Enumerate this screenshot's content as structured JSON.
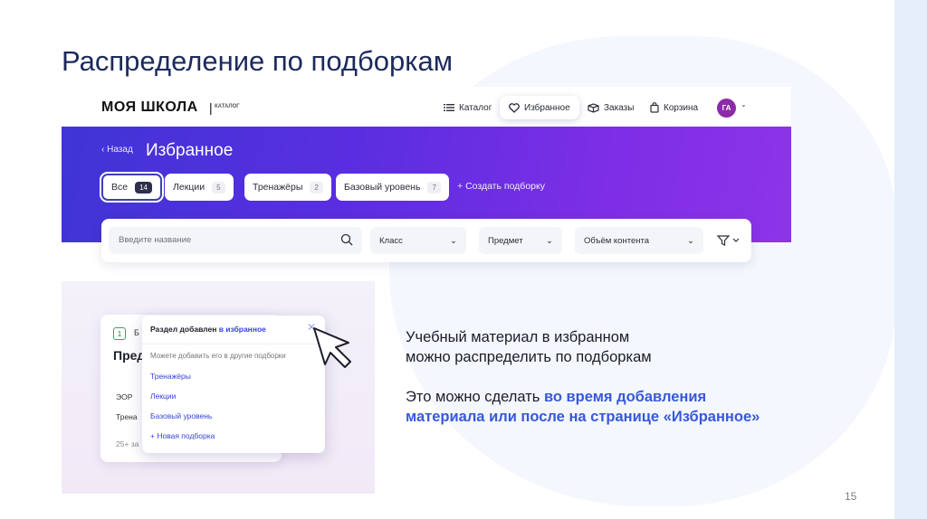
{
  "slide": {
    "title": "Распределение по подборкам",
    "page_number": "15"
  },
  "app": {
    "logo": "МОЯ ШКОЛА",
    "logo_separator": "|",
    "logo_sub": "КАТАЛОГ",
    "nav": {
      "catalog": "Каталог",
      "favorites": "Избранное",
      "orders": "Заказы",
      "cart": "Корзина"
    },
    "avatar_initials": "ГА"
  },
  "hero": {
    "back_label": "Назад",
    "title": "Избранное",
    "chips": [
      {
        "label": "Все",
        "count": "14"
      },
      {
        "label": "Лекции",
        "count": "5"
      },
      {
        "label": "Тренажёры",
        "count": "2"
      },
      {
        "label": "Базовый уровень",
        "count": "7"
      }
    ],
    "create_label": "Создать подборку"
  },
  "filters": {
    "search_placeholder": "Введите название",
    "class_label": "Класс",
    "subject_label": "Предмет",
    "volume_label": "Объём контента"
  },
  "illustration": {
    "card_number": "1",
    "card_b": "Б",
    "card_title_fragment": "Пред",
    "card_row1": "ЭОР",
    "card_row2": "Трена",
    "card_count": "25+ за",
    "popup": {
      "head_prefix": "Раздел добавлен ",
      "head_link": "в избранное",
      "hint": "Можете добавить его в другие подборки",
      "options": [
        "Тренажёры",
        "Лекции",
        "Базовый уровень"
      ],
      "new_collection": "Новая подборка"
    }
  },
  "description": {
    "line1": "Учебный материал в избранном",
    "line2": "можно распределить по подборкам",
    "line3_prefix": "Это можно сделать ",
    "line3_highlight": "во время добавления",
    "line4_highlight": "материала или после на странице «Избранное»"
  },
  "colors": {
    "title": "#1c2a5c",
    "hero_gradient_start": "#3f35d6",
    "hero_gradient_end": "#8c34e8",
    "highlight": "#3759d9",
    "avatar": "#8c2aa8"
  }
}
